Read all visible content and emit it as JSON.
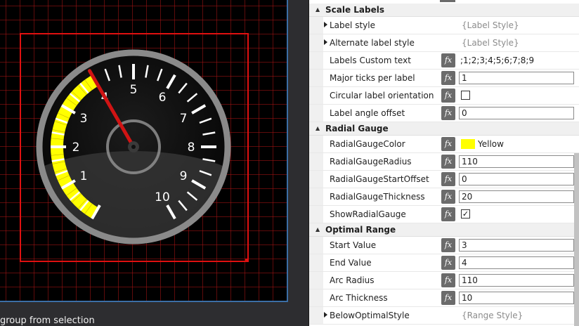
{
  "gauge": {
    "labels": [
      "1",
      "2",
      "3",
      "4",
      "5",
      "6",
      "7",
      "8",
      "9",
      "10"
    ],
    "needle_value": 4,
    "gauge_color": "#ffff00",
    "needle_color": "#d01414"
  },
  "status": {
    "text": "group from selection"
  },
  "properties": {
    "scale_labels": {
      "header": "Scale Labels",
      "label_style": {
        "name": "Label style",
        "value": "{Label Style}"
      },
      "alternate_label_style": {
        "name": "Alternate label style",
        "value": "{Label Style}"
      },
      "labels_custom_text": {
        "name": "Labels Custom text",
        "value": ";1;2;3;4;5;6;7;8;9"
      },
      "major_ticks_per_label": {
        "name": "Major ticks per label",
        "value": "1"
      },
      "circular_label_orientation": {
        "name": "Circular label orientation",
        "checked": false
      },
      "label_angle_offset": {
        "name": "Label angle offset",
        "value": "0"
      }
    },
    "radial_gauge": {
      "header": "Radial Gauge",
      "color": {
        "name": "RadialGaugeColor",
        "value": "Yellow",
        "swatch": "#ffff00"
      },
      "radius": {
        "name": "RadialGaugeRadius",
        "value": "110"
      },
      "start_offset": {
        "name": "RadialGaugeStartOffset",
        "value": "0"
      },
      "thickness": {
        "name": "RadialGaugeThickness",
        "value": "20"
      },
      "show": {
        "name": "ShowRadialGauge",
        "checked": true
      }
    },
    "optimal_range": {
      "header": "Optimal Range",
      "start_value": {
        "name": "Start Value",
        "value": "3"
      },
      "end_value": {
        "name": "End Value",
        "value": "4"
      },
      "arc_radius": {
        "name": "Arc Radius",
        "value": "110"
      },
      "arc_thickness": {
        "name": "Arc Thickness",
        "value": "10"
      },
      "below_optimal_style": {
        "name": "BelowOptimalStyle",
        "value": "{Range Style}"
      }
    },
    "fx_label": "fx"
  }
}
